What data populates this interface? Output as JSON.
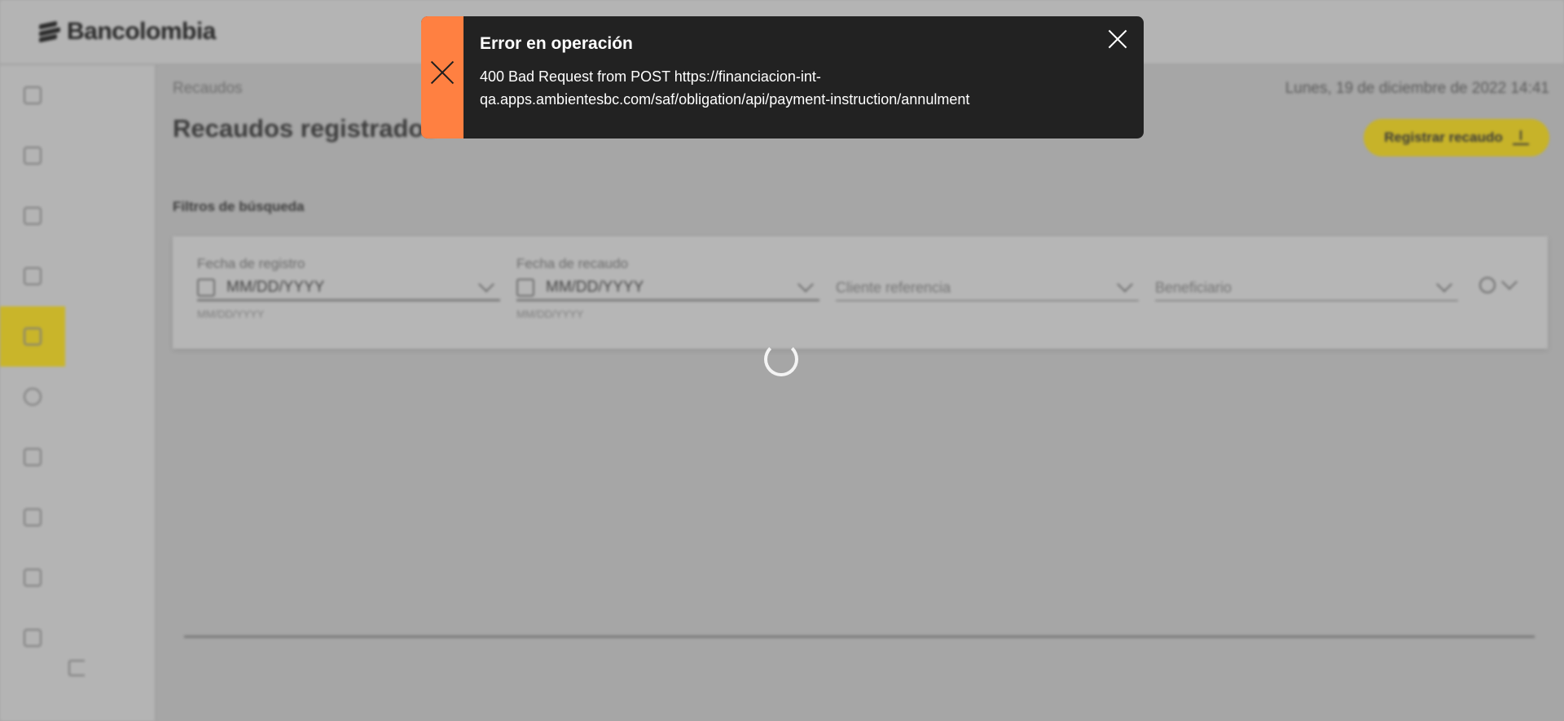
{
  "app": {
    "brand": "Bancolombia",
    "colors": {
      "accent": "#c7b329",
      "error_stripe": "#ff8041",
      "toast_bg": "#222222"
    }
  },
  "sidebar": {
    "items": [
      {
        "icon": "dashboard-icon",
        "active": false
      },
      {
        "icon": "document-icon",
        "active": false
      },
      {
        "icon": "cash-icon",
        "active": false
      },
      {
        "icon": "report-icon",
        "active": false
      },
      {
        "icon": "transfer-arrows-icon",
        "active": true
      },
      {
        "icon": "settings-icon",
        "active": false
      },
      {
        "icon": "file-icon",
        "active": false
      },
      {
        "icon": "table-icon",
        "active": false
      },
      {
        "icon": "receipt-icon",
        "active": false
      },
      {
        "icon": "chart-icon",
        "active": false
      }
    ],
    "logout_icon": "logout-icon"
  },
  "main": {
    "breadcrumb": "Recaudos",
    "datetime": "Lunes, 19 de diciembre de 2022 14:41",
    "title": "Recaudos registrados",
    "register_button": "Registrar recaudo",
    "filters_label": "Filtros de búsqueda",
    "filters": {
      "fecha_registro": {
        "label": "Fecha de registro",
        "value": "MM/DD/YYYY",
        "hint": "MM/DD/YYYY"
      },
      "fecha_recaudo": {
        "label": "Fecha de recaudo",
        "value": "MM/DD/YYYY",
        "hint": "MM/DD/YYYY"
      },
      "cliente_referencia": {
        "placeholder": "Cliente referencia"
      },
      "beneficiario": {
        "placeholder": "Beneficiario"
      }
    }
  },
  "toast": {
    "title": "Error en operación",
    "message": "400 Bad Request from POST https://financiacion-int-qa.apps.ambientesbc.com/saf/obligation/api/payment-instruction/annulment"
  }
}
